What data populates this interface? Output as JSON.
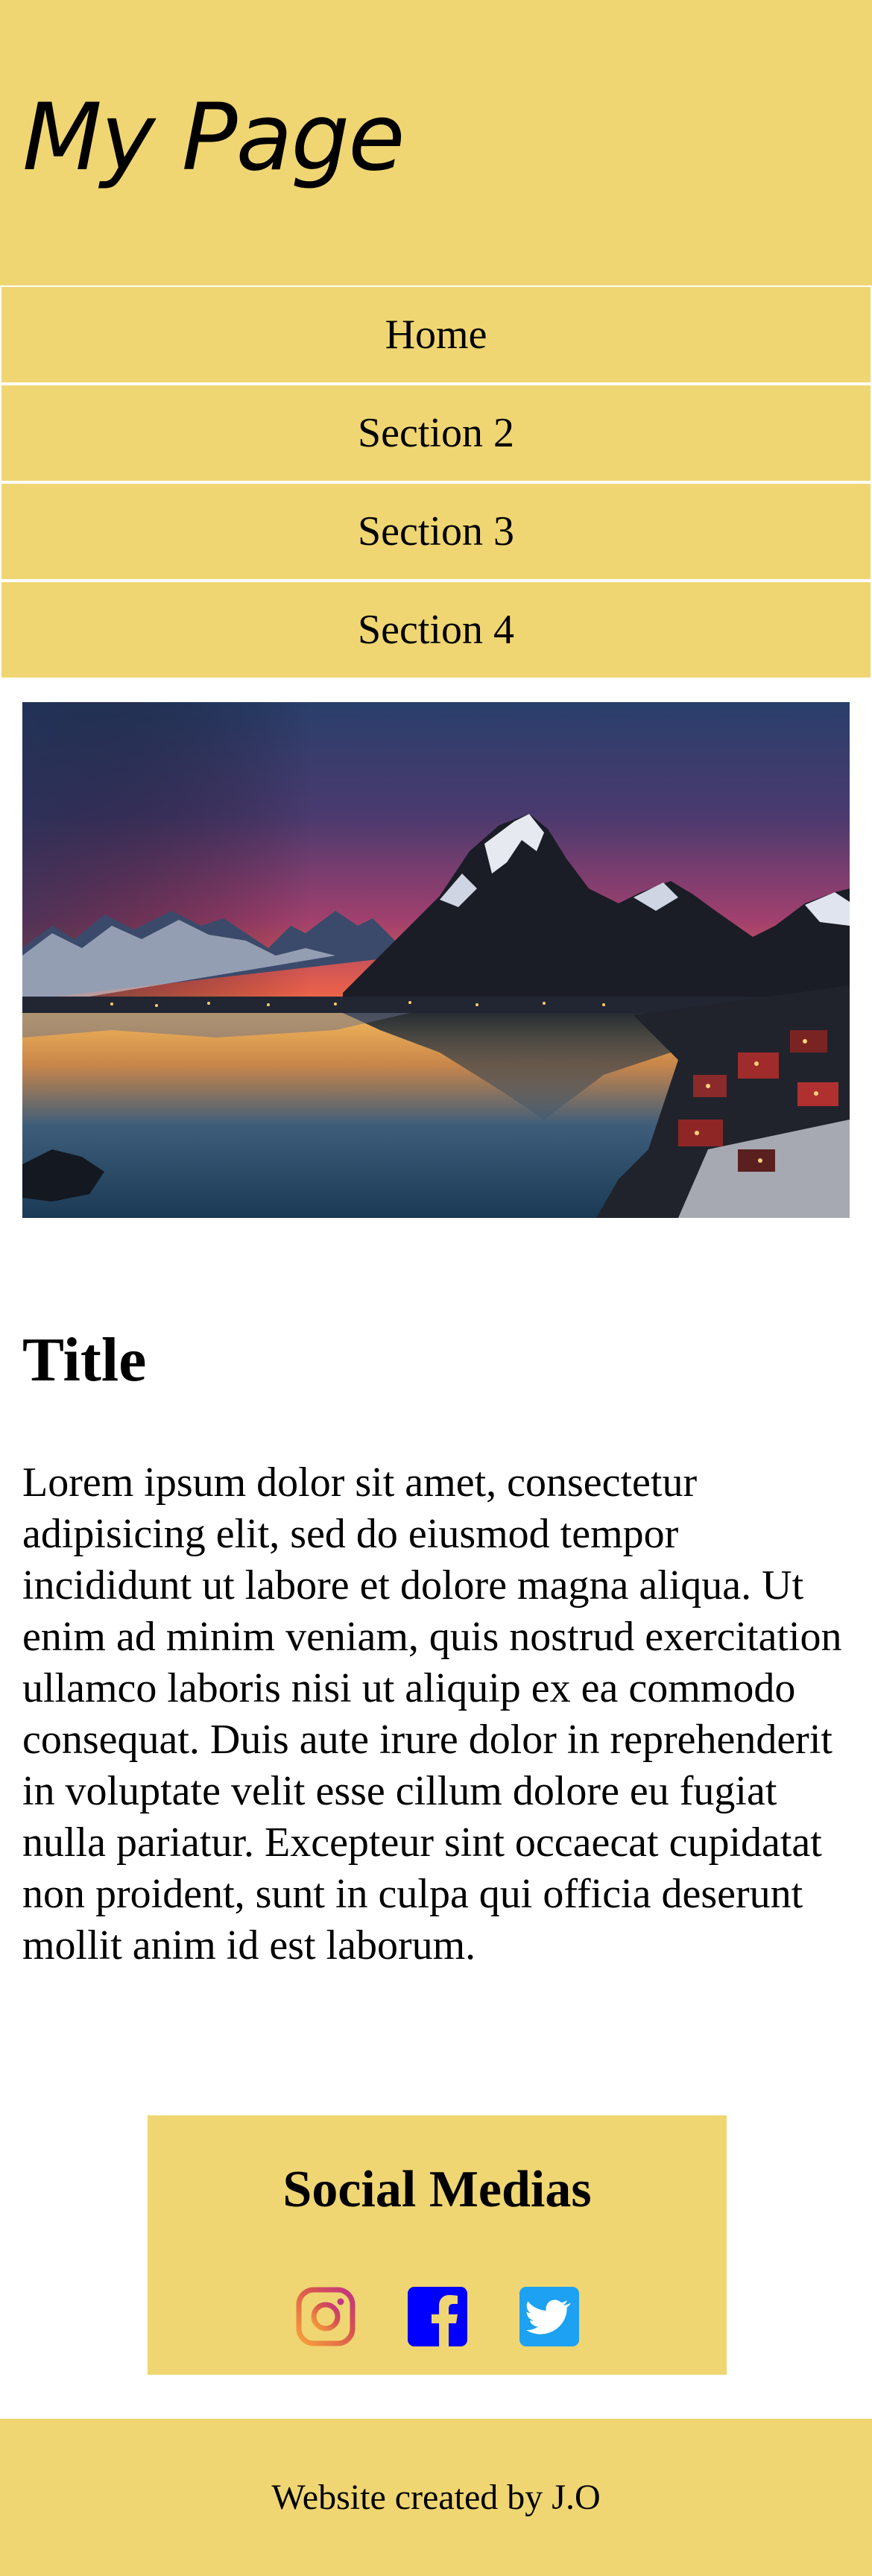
{
  "header": {
    "title": "My Page"
  },
  "nav": {
    "items": [
      {
        "label": "Home"
      },
      {
        "label": "Section 2"
      },
      {
        "label": "Section 3"
      },
      {
        "label": "Section 4"
      }
    ]
  },
  "hero": {
    "image": "mountain-lake-sunset"
  },
  "content": {
    "title": "Title",
    "body": "Lorem ipsum dolor sit amet, consectetur adipisicing elit, sed do eiusmod tempor incididunt ut labore et dolore magna aliqua. Ut enim ad minim veniam, quis nostrud exercitation ullamco laboris nisi ut aliquip ex ea commodo consequat. Duis aute irure dolor in reprehenderit in voluptate velit esse cillum dolore eu fugiat nulla pariatur. Excepteur sint occaecat cupidatat non proident, sunt in culpa qui officia deserunt mollit anim id est laborum."
  },
  "social": {
    "title": "Social Medias",
    "icons": [
      "instagram-icon",
      "facebook-icon",
      "twitter-icon"
    ]
  },
  "footer": {
    "text": "Website created by J.O"
  },
  "colors": {
    "accent": "#efd672",
    "facebook": "#0000ff",
    "twitter": "#1da1f2",
    "instagram_start": "#f9a33b",
    "instagram_end": "#c13584"
  }
}
